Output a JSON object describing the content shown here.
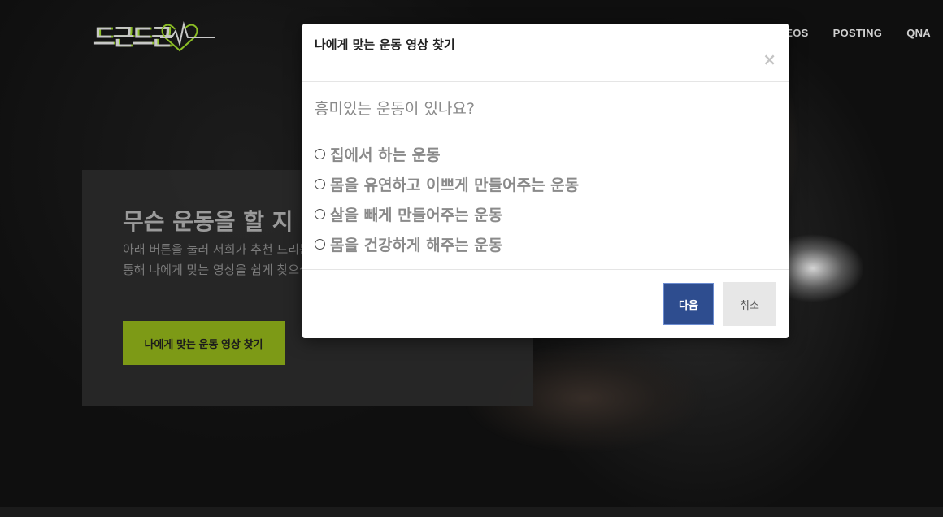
{
  "logo": {
    "text": "드근드근"
  },
  "nav": {
    "items": [
      "VIDEOS",
      "POSTING",
      "QNA"
    ]
  },
  "cta": {
    "title": "무슨 운동을 할 지",
    "desc_line1": "아래 버튼을 눌러 저희가 추천 드리는",
    "desc_line2": "통해 나에게 맞는 영상을 쉽게 찾으실",
    "button": "나에게 맞는 운동 영상 찾기"
  },
  "modal": {
    "title": "나에게 맞는 운동 영상 찾기",
    "close": "×",
    "question": "흥미있는 운동이 있나요?",
    "options": [
      "집에서 하는 운동",
      "몸을 유연하고 이쁘게 만들어주는 운동",
      "살을 빼게 만들어주는 운동",
      "몸을 건강하게 해주는 운동"
    ],
    "next": "다음",
    "cancel": "취소"
  },
  "colors": {
    "accent": "#7d9a16",
    "primary_button": "#2e4d8f"
  }
}
